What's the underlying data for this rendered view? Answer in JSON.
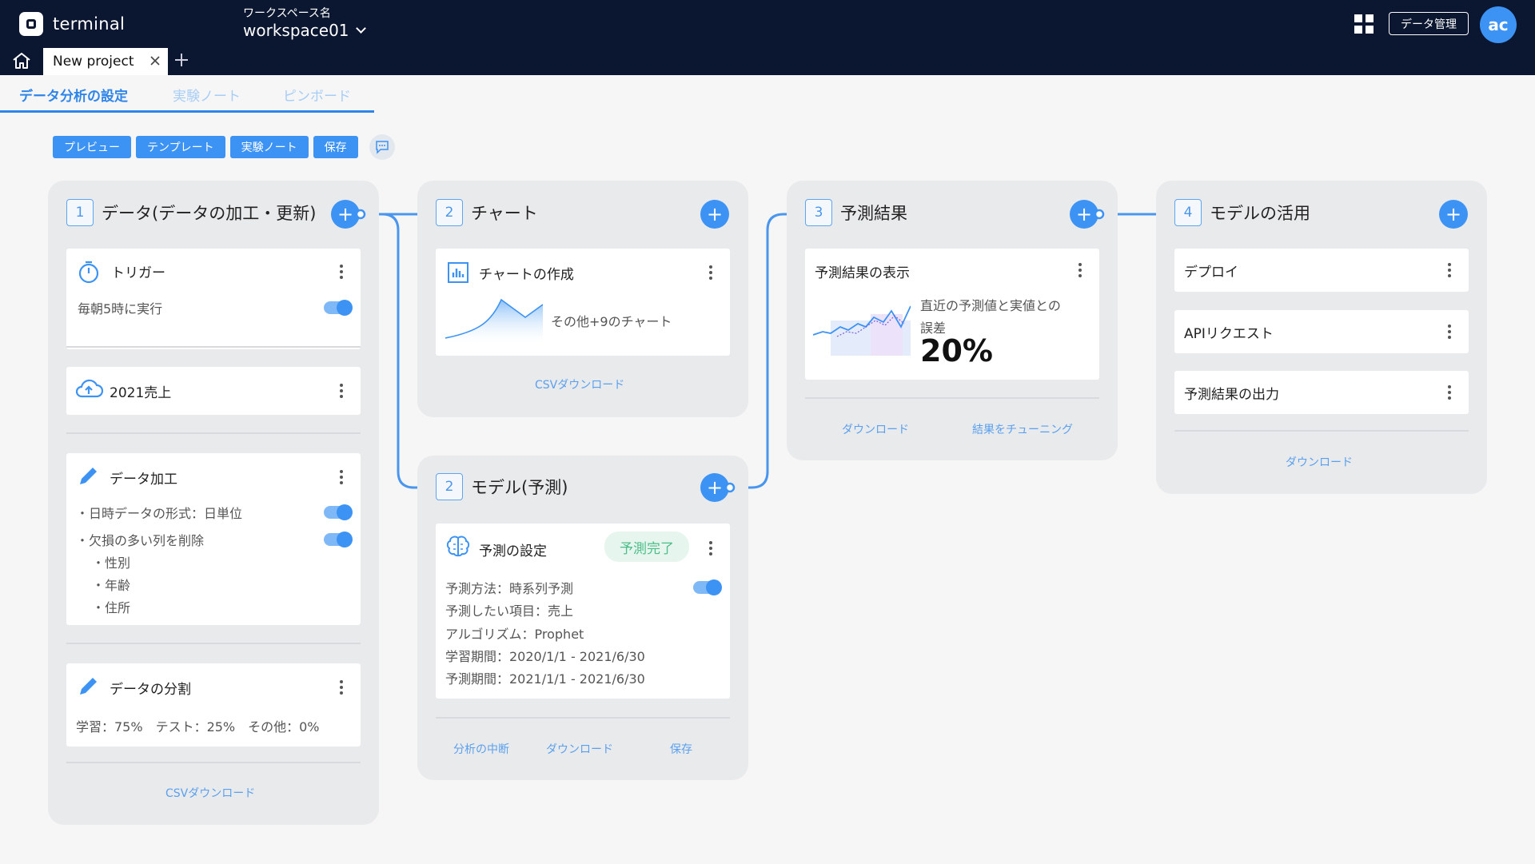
{
  "header": {
    "app_name": "terminal",
    "workspace_label": "ワークスペース名",
    "workspace_value": "workspace01",
    "data_admin_label": "データ管理",
    "avatar_initials": "ac"
  },
  "project_tab": {
    "label": "New project"
  },
  "subtabs": [
    {
      "label": "データ分析の設定",
      "active": true
    },
    {
      "label": "実験ノート",
      "active": false
    },
    {
      "label": "ピンボード",
      "active": false
    }
  ],
  "toolbar": {
    "preview": "プレビュー",
    "template": "テンプレート",
    "notebook": "実験ノート",
    "save": "保存"
  },
  "panel1": {
    "num": "1",
    "title": "データ(データの加工・更新)",
    "trigger_title": "トリガー",
    "trigger_desc": "毎朝5時に実行",
    "source_title": "2021売上",
    "process_title": "データ加工",
    "process_item1": "・日時データの形式：日単位",
    "process_item2": "・欠損の多い列を削除",
    "process_sub1": "・性別",
    "process_sub2": "・年齢",
    "process_sub3": "・住所",
    "split_title": "データの分割",
    "split_desc": "学習：75%　テスト：25%　その他：0%",
    "csv_link": "CSVダウンロード"
  },
  "panel2": {
    "num": "2",
    "title": "チャート",
    "card_title": "チャートの作成",
    "card_more": "その他+9のチャート",
    "csv_link": "CSVダウンロード"
  },
  "panel_model": {
    "num": "2",
    "title": "モデル(予測)",
    "card_title": "予測の設定",
    "status": "予測完了",
    "line1": "予測方法：時系列予測",
    "line2": "予測したい項目：売上",
    "line3": "アルゴリズム：Prophet",
    "line4": "学習期間：2020/1/1 - 2021/6/30",
    "line5": "予測期間：2021/1/1 - 2021/6/30",
    "link_stop": "分析の中断",
    "link_download": "ダウンロード",
    "link_save": "保存"
  },
  "panel3": {
    "num": "3",
    "title": "予測結果",
    "card_title": "予測結果の表示",
    "metric_label_1": "直近の予測値と実値との",
    "metric_label_2": "誤差",
    "metric_value": "20%",
    "link_download": "ダウンロード",
    "link_tuning": "結果をチューニング"
  },
  "panel4": {
    "num": "4",
    "title": "モデルの活用",
    "item1": "デプロイ",
    "item2": "APIリクエスト",
    "item3": "予測結果の出力",
    "link_download": "ダウンロード"
  },
  "colors": {
    "header_bg": "#0b1630",
    "accent": "#3d93f4",
    "panel_bg": "#e9eaec",
    "status_green": "#4dbd88"
  },
  "icons": [
    "home-icon",
    "close-icon",
    "add-tab-icon",
    "apps-grid-icon",
    "comment-icon",
    "timer-icon",
    "cloud-upload-icon",
    "pencil-icon",
    "bar-chart-icon",
    "brain-icon",
    "kebab-icon"
  ]
}
